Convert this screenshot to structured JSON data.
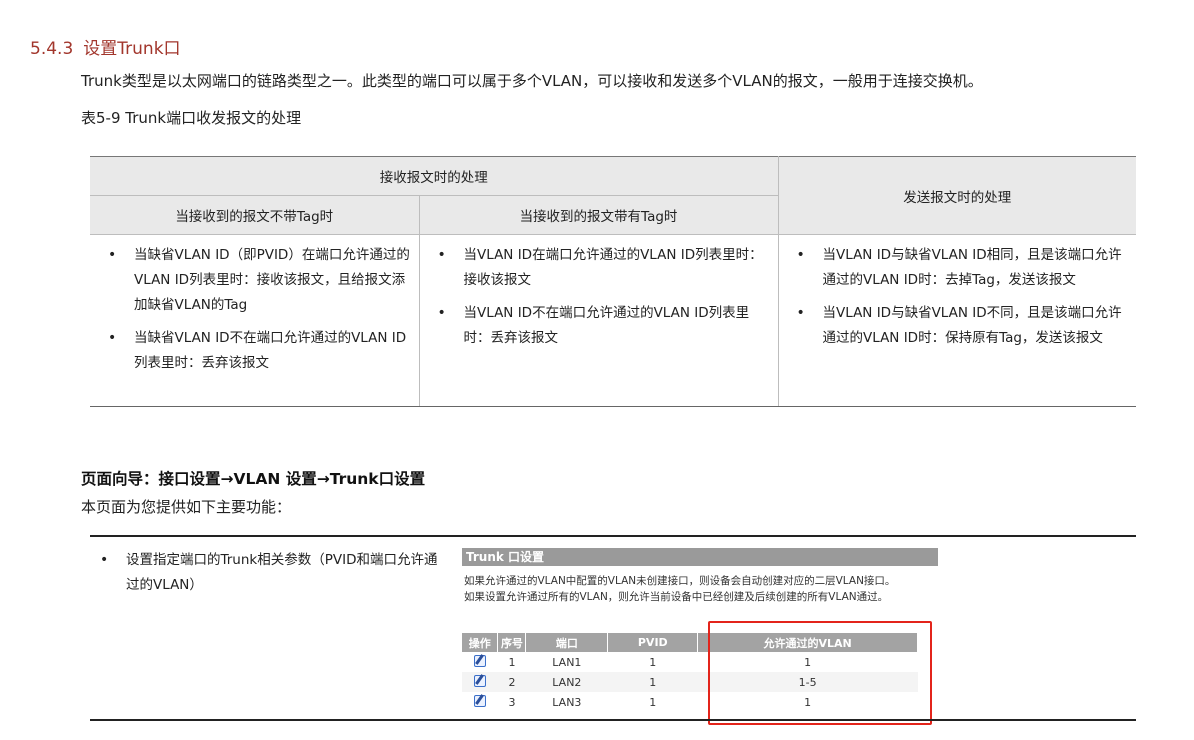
{
  "section": {
    "number": "5.4.3",
    "title": "设置Trunk口"
  },
  "intro": "Trunk类型是以太网端口的链路类型之一。此类型的端口可以属于多个VLAN，可以接收和发送多个VLAN的报文，一般用于连接交换机。",
  "table_caption": "表5-9 Trunk端口收发报文的处理",
  "table": {
    "header_receive": "接收报文时的处理",
    "header_send": "发送报文时的处理",
    "sub_untagged": "当接收到的报文不带Tag时",
    "sub_tagged": "当接收到的报文带有Tag时",
    "col_untagged": [
      "当缺省VLAN ID（即PVID）在端口允许通过的VLAN ID列表里时：接收该报文，且给报文添加缺省VLAN的Tag",
      "当缺省VLAN ID不在端口允许通过的VLAN ID列表里时：丢弃该报文"
    ],
    "col_tagged": [
      "当VLAN ID在端口允许通过的VLAN ID列表里时：接收该报文",
      "当VLAN ID不在端口允许通过的VLAN ID列表里时：丢弃该报文"
    ],
    "col_send": [
      "当VLAN ID与缺省VLAN ID相同，且是该端口允许通过的VLAN ID时：去掉Tag，发送该报文",
      "当VLAN ID与缺省VLAN ID不同，且是该端口允许通过的VLAN ID时：保持原有Tag，发送该报文"
    ]
  },
  "guide": "页面向导：接口设置→VLAN 设置→Trunk口设置",
  "guide_desc": "本页面为您提供如下主要功能：",
  "features": [
    "设置指定端口的Trunk相关参数（PVID和端口允许通过的VLAN）"
  ],
  "screenshot": {
    "title": "Trunk 口设置",
    "note1": "如果允许通过的VLAN中配置的VLAN未创建接口，则设备会自动创建对应的二层VLAN接口。",
    "note2": "如果设置允许通过所有的VLAN，则允许当前设备中已经创建及后续创建的所有VLAN通过。",
    "headers": [
      "操作",
      "序号",
      "端口",
      "PVID",
      "允许通过的VLAN"
    ],
    "rows": [
      {
        "no": "1",
        "port": "LAN1",
        "pvid": "1",
        "vlan": "1"
      },
      {
        "no": "2",
        "port": "LAN2",
        "pvid": "1",
        "vlan": "1-5"
      },
      {
        "no": "3",
        "port": "LAN3",
        "pvid": "1",
        "vlan": "1"
      }
    ],
    "edit_icon": "edit-icon",
    "highlight_color": "#e3241b"
  }
}
